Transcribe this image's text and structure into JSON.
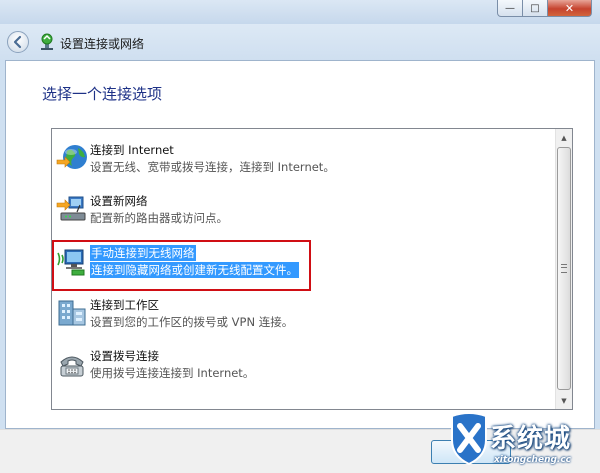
{
  "window": {
    "title": "设置连接或网络",
    "controls": {
      "minimize": "—",
      "maximize": "□",
      "close": "✕"
    }
  },
  "page": {
    "heading": "选择一个连接选项"
  },
  "options": [
    {
      "title": "连接到 Internet",
      "description": "设置无线、宽带或拨号连接，连接到 Internet。",
      "icon": "globe-icon"
    },
    {
      "title": "设置新网络",
      "description": "配置新的路由器或访问点。",
      "icon": "router-icon"
    },
    {
      "title": "手动连接到无线网络",
      "description": "连接到隐藏网络或创建新无线配置文件。",
      "icon": "wireless-computer-icon",
      "selected": true
    },
    {
      "title": "连接到工作区",
      "description": "设置到您的工作区的拨号或 VPN 连接。",
      "icon": "workplace-icon"
    },
    {
      "title": "设置拨号连接",
      "description": "使用拨号连接连接到 Internet。",
      "icon": "telephone-icon"
    }
  ],
  "footer": {
    "next_label": ""
  },
  "watermark": {
    "brand": "系统城",
    "url": "xitongcheng.cc"
  },
  "colors": {
    "selection": "#3399ff",
    "highlight_frame": "#d00e14",
    "heading": "#1e3287"
  }
}
